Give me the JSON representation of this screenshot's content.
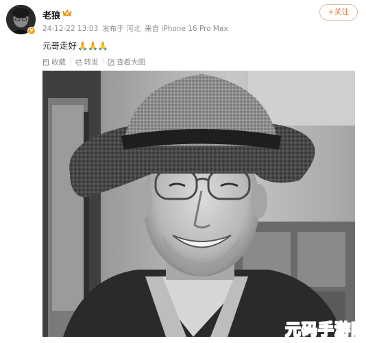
{
  "post": {
    "username": "老狼",
    "timestamp": "24-12-22 13:03",
    "location": "发布于 河北",
    "device": "来自 iPhone 16 Pro Max",
    "text": "元哥走好",
    "emoji": "🙏🙏🙏"
  },
  "follow_button": {
    "label": "+关注"
  },
  "actions": {
    "favorite": "收藏",
    "repost": "转发",
    "view_large": "查看大图"
  },
  "watermark": {
    "text": "元码手游网"
  },
  "colors": {
    "accent": "#e0733a",
    "meta": "#8c8c8c",
    "watermark": "#f29b3c"
  },
  "icons": [
    "crown-icon",
    "favorite-icon",
    "repost-icon",
    "view-large-icon",
    "verified-badge-icon"
  ]
}
